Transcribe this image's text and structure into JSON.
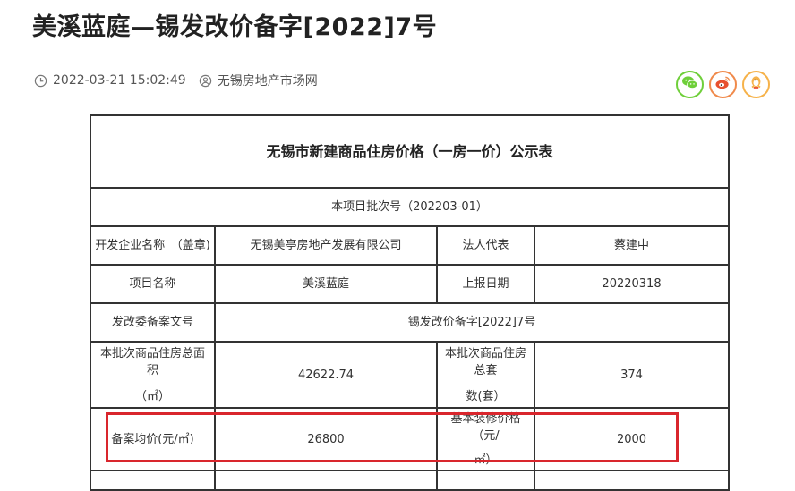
{
  "article": {
    "title": "美溪蓝庭—锡发改价备字[2022]7号",
    "datetime": "2022-03-21 15:02:49",
    "source": "无锡房地产市场网"
  },
  "share": {
    "icons": [
      "wechat-icon",
      "weibo-icon",
      "qzone-icon"
    ],
    "colors": {
      "wechat": "#6fcf3a",
      "weibo": "#f08a4b",
      "qzone": "#f6b24a"
    }
  },
  "notice": {
    "caption": "无锡市新建商品住房价格（一房一价）公示表",
    "batch": "本项目批次号（202203-01）",
    "rows": {
      "developer_label": "开发企业名称　（盖章)",
      "developer_value": "无锡美亭房地产发展有限公司",
      "legal_rep_label": "法人代表",
      "legal_rep_value": "蔡建中",
      "project_label": "项目名称",
      "project_value": "美溪蓝庭",
      "report_date_label": "上报日期",
      "report_date_value": "20220318",
      "ndrc_label": "发改委备案文号",
      "ndrc_value": "锡发改价备字[2022]7号",
      "area_label_line1": "本批次商品住房总面积",
      "area_label_line2": "（㎡）",
      "area_value": "42622.74",
      "units_label_line1": "本批次商品住房总套",
      "units_label_line2": "数(套）",
      "units_value": "374",
      "avg_price_label": "备案均价(元/㎡)",
      "avg_price_value": "26800",
      "decoration_label_line1": "基本装修价格（元/",
      "decoration_label_line2": "㎡）",
      "decoration_value": "2000"
    }
  },
  "highlight_color": "#d9262d"
}
